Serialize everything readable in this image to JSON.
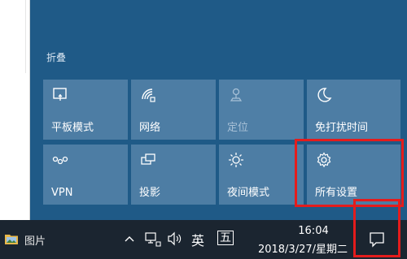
{
  "action_center": {
    "collapse_label": "折叠",
    "tiles": [
      {
        "label": "平板模式",
        "icon": "tablet-mode-icon",
        "enabled": true
      },
      {
        "label": "网络",
        "icon": "network-icon",
        "enabled": true
      },
      {
        "label": "定位",
        "icon": "location-icon",
        "enabled": false
      },
      {
        "label": "免打扰时间",
        "icon": "moon-icon",
        "enabled": true
      },
      {
        "label": "VPN",
        "icon": "vpn-icon",
        "enabled": true
      },
      {
        "label": "投影",
        "icon": "project-icon",
        "enabled": true
      },
      {
        "label": "夜间模式",
        "icon": "brightness-icon",
        "enabled": true
      },
      {
        "label": "所有设置",
        "icon": "gear-icon",
        "enabled": true
      }
    ]
  },
  "taskbar": {
    "app_name": "图片",
    "ime_lang": "英",
    "ime_mode": "五",
    "time": "16:04",
    "date": "2018/3/27/星期二"
  },
  "colors": {
    "accent": "#1f5a87",
    "tile": "#4d7da4",
    "highlight": "#e41c1c",
    "taskbar": "#1b2530"
  }
}
